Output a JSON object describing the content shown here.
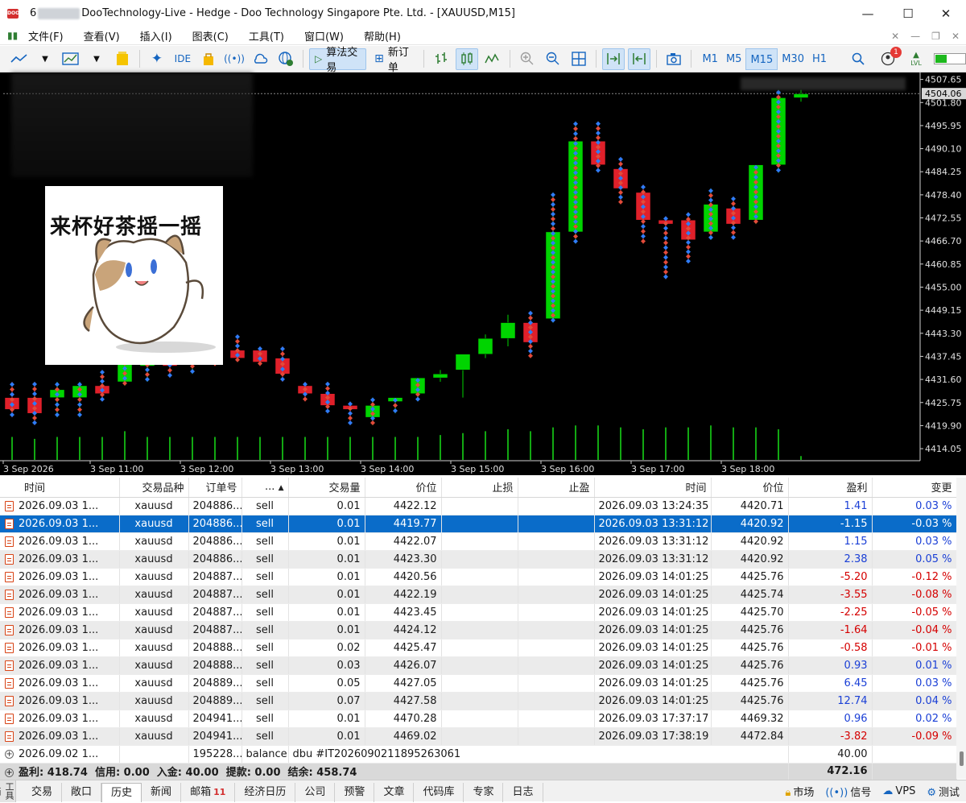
{
  "window": {
    "title_prefix": "6",
    "title_main": "DooTechnology-Live - Hedge - Doo Technology Singapore Pte. Ltd. - [XAUUSD,M15]",
    "minimize": "—",
    "maximize": "☐",
    "close": "✕"
  },
  "menu": {
    "items": [
      "文件(F)",
      "查看(V)",
      "插入(I)",
      "图表(C)",
      "工具(T)",
      "窗口(W)",
      "帮助(H)"
    ]
  },
  "toolbar": {
    "ide_label": "IDE",
    "algo_trading_label": "算法交易",
    "new_order_label": "新订单",
    "timeframes": [
      "M1",
      "M5",
      "M15",
      "M30",
      "H1"
    ],
    "active_timeframe": "M15",
    "notification_count": "1",
    "level_label": "LVL"
  },
  "chart": {
    "symbol": "XAUUSD",
    "timeframe": "M15",
    "sticker_text": "来杯好茶摇一摇",
    "current_price": "4504.06",
    "price_ticks": [
      "4507.65",
      "4501.80",
      "4495.95",
      "4490.10",
      "4484.25",
      "4478.40",
      "4472.55",
      "4466.70",
      "4460.85",
      "4455.00",
      "4449.15",
      "4443.30",
      "4437.45",
      "4431.60",
      "4425.75",
      "4419.90",
      "4414.05"
    ],
    "time_ticks": [
      "3 Sep 2026",
      "3 Sep 11:00",
      "3 Sep 12:00",
      "3 Sep 13:00",
      "3 Sep 14:00",
      "3 Sep 15:00",
      "3 Sep 16:00",
      "3 Sep 17:00",
      "3 Sep 18:00"
    ],
    "colors": {
      "bull": "#00d400",
      "bear": "#e0202a",
      "background": "#000000",
      "grid": "#1a1a1a",
      "volume": "#12a812"
    }
  },
  "chart_data": {
    "type": "candlestick",
    "symbol": "XAUUSD",
    "timeframe": "M15",
    "ylim": [
      4411,
      4509
    ],
    "candles": [
      {
        "o": 4427,
        "h": 4431,
        "l": 4422,
        "c": 4424
      },
      {
        "o": 4427,
        "h": 4431,
        "l": 4420,
        "c": 4423
      },
      {
        "o": 4427,
        "h": 4431,
        "l": 4422,
        "c": 4429
      },
      {
        "o": 4427,
        "h": 4431,
        "l": 4422,
        "c": 4430
      },
      {
        "o": 4430,
        "h": 4434,
        "l": 4426,
        "c": 4428
      },
      {
        "o": 4431,
        "h": 4445,
        "l": 4430,
        "c": 4443
      },
      {
        "o": 4435,
        "h": 4442,
        "l": 4431,
        "c": 4441
      },
      {
        "o": 4440,
        "h": 4441,
        "l": 4432,
        "c": 4435
      },
      {
        "o": 4438,
        "h": 4442,
        "l": 4433,
        "c": 4441
      },
      {
        "o": 4438,
        "h": 4442,
        "l": 4435,
        "c": 4437
      },
      {
        "o": 4439,
        "h": 4443,
        "l": 4436,
        "c": 4437
      },
      {
        "o": 4439,
        "h": 4440,
        "l": 4435,
        "c": 4436
      },
      {
        "o": 4437,
        "h": 4440,
        "l": 4431,
        "c": 4433
      },
      {
        "o": 4430,
        "h": 4431,
        "l": 4426,
        "c": 4428
      },
      {
        "o": 4428,
        "h": 4431,
        "l": 4423,
        "c": 4425
      },
      {
        "o": 4425,
        "h": 4426,
        "l": 4420,
        "c": 4424
      },
      {
        "o": 4422,
        "h": 4427,
        "l": 4420,
        "c": 4425
      },
      {
        "o": 4426,
        "h": 4427,
        "l": 4423,
        "c": 4427
      },
      {
        "o": 4428,
        "h": 4432,
        "l": 4426,
        "c": 4432
      },
      {
        "o": 4432,
        "h": 4434,
        "l": 4431,
        "c": 4433
      },
      {
        "o": 4434,
        "h": 4438,
        "l": 4427,
        "c": 4438
      },
      {
        "o": 4438,
        "h": 4443,
        "l": 4437,
        "c": 4442
      },
      {
        "o": 4442,
        "h": 4448,
        "l": 4440,
        "c": 4446
      },
      {
        "o": 4446,
        "h": 4449,
        "l": 4437,
        "c": 4441
      },
      {
        "o": 4447,
        "h": 4479,
        "l": 4446,
        "c": 4469
      },
      {
        "o": 4469,
        "h": 4497,
        "l": 4466,
        "c": 4492
      },
      {
        "o": 4492,
        "h": 4497,
        "l": 4484,
        "c": 4486
      },
      {
        "o": 4485,
        "h": 4488,
        "l": 4476,
        "c": 4480
      },
      {
        "o": 4479,
        "h": 4481,
        "l": 4466,
        "c": 4472
      },
      {
        "o": 4472,
        "h": 4473,
        "l": 4457,
        "c": 4471
      },
      {
        "o": 4472,
        "h": 4474,
        "l": 4461,
        "c": 4467
      },
      {
        "o": 4469,
        "h": 4480,
        "l": 4467,
        "c": 4476
      },
      {
        "o": 4475,
        "h": 4478,
        "l": 4467,
        "c": 4471
      },
      {
        "o": 4472,
        "h": 4486,
        "l": 4471,
        "c": 4486
      },
      {
        "o": 4486,
        "h": 4505,
        "l": 4484,
        "c": 4503
      },
      {
        "o": 4503,
        "h": 4505,
        "l": 4502,
        "c": 4504
      }
    ],
    "volume": [
      12,
      11,
      12,
      12,
      12,
      15,
      12,
      12,
      12,
      12,
      12,
      12,
      12,
      12,
      12,
      12,
      12,
      12,
      12,
      13,
      14,
      15,
      16,
      15,
      17,
      18,
      18,
      17,
      16,
      17,
      17,
      18,
      17,
      17,
      16,
      2
    ]
  },
  "history": {
    "columns": [
      "时间",
      "交易品种",
      "订单号",
      "...",
      "交易量",
      "价位",
      "止损",
      "止盈",
      "时间",
      "价位",
      "盈利",
      "变更"
    ],
    "rows": [
      {
        "open_time": "2026.09.03 1...",
        "symbol": "xauusd",
        "ticket": "204886...",
        "type": "sell",
        "volume": "0.01",
        "open_price": "4422.12",
        "sl": "",
        "tp": "",
        "close_time": "2026.09.03 13:24:35",
        "close_price": "4420.71",
        "profit": "1.41",
        "change": "0.03 %",
        "sign": "pos",
        "selected": false
      },
      {
        "open_time": "2026.09.03 1...",
        "symbol": "xauusd",
        "ticket": "204886...",
        "type": "sell",
        "volume": "0.01",
        "open_price": "4419.77",
        "sl": "",
        "tp": "",
        "close_time": "2026.09.03 13:31:12",
        "close_price": "4420.92",
        "profit": "-1.15",
        "change": "-0.03 %",
        "sign": "neg",
        "selected": true
      },
      {
        "open_time": "2026.09.03 1...",
        "symbol": "xauusd",
        "ticket": "204886...",
        "type": "sell",
        "volume": "0.01",
        "open_price": "4422.07",
        "sl": "",
        "tp": "",
        "close_time": "2026.09.03 13:31:12",
        "close_price": "4420.92",
        "profit": "1.15",
        "change": "0.03 %",
        "sign": "pos",
        "selected": false
      },
      {
        "open_time": "2026.09.03 1...",
        "symbol": "xauusd",
        "ticket": "204886...",
        "type": "sell",
        "volume": "0.01",
        "open_price": "4423.30",
        "sl": "",
        "tp": "",
        "close_time": "2026.09.03 13:31:12",
        "close_price": "4420.92",
        "profit": "2.38",
        "change": "0.05 %",
        "sign": "pos",
        "selected": false
      },
      {
        "open_time": "2026.09.03 1...",
        "symbol": "xauusd",
        "ticket": "204887...",
        "type": "sell",
        "volume": "0.01",
        "open_price": "4420.56",
        "sl": "",
        "tp": "",
        "close_time": "2026.09.03 14:01:25",
        "close_price": "4425.76",
        "profit": "-5.20",
        "change": "-0.12 %",
        "sign": "neg",
        "selected": false
      },
      {
        "open_time": "2026.09.03 1...",
        "symbol": "xauusd",
        "ticket": "204887...",
        "type": "sell",
        "volume": "0.01",
        "open_price": "4422.19",
        "sl": "",
        "tp": "",
        "close_time": "2026.09.03 14:01:25",
        "close_price": "4425.74",
        "profit": "-3.55",
        "change": "-0.08 %",
        "sign": "neg",
        "selected": false
      },
      {
        "open_time": "2026.09.03 1...",
        "symbol": "xauusd",
        "ticket": "204887...",
        "type": "sell",
        "volume": "0.01",
        "open_price": "4423.45",
        "sl": "",
        "tp": "",
        "close_time": "2026.09.03 14:01:25",
        "close_price": "4425.70",
        "profit": "-2.25",
        "change": "-0.05 %",
        "sign": "neg",
        "selected": false
      },
      {
        "open_time": "2026.09.03 1...",
        "symbol": "xauusd",
        "ticket": "204887...",
        "type": "sell",
        "volume": "0.01",
        "open_price": "4424.12",
        "sl": "",
        "tp": "",
        "close_time": "2026.09.03 14:01:25",
        "close_price": "4425.76",
        "profit": "-1.64",
        "change": "-0.04 %",
        "sign": "neg",
        "selected": false
      },
      {
        "open_time": "2026.09.03 1...",
        "symbol": "xauusd",
        "ticket": "204888...",
        "type": "sell",
        "volume": "0.02",
        "open_price": "4425.47",
        "sl": "",
        "tp": "",
        "close_time": "2026.09.03 14:01:25",
        "close_price": "4425.76",
        "profit": "-0.58",
        "change": "-0.01 %",
        "sign": "neg",
        "selected": false
      },
      {
        "open_time": "2026.09.03 1...",
        "symbol": "xauusd",
        "ticket": "204888...",
        "type": "sell",
        "volume": "0.03",
        "open_price": "4426.07",
        "sl": "",
        "tp": "",
        "close_time": "2026.09.03 14:01:25",
        "close_price": "4425.76",
        "profit": "0.93",
        "change": "0.01 %",
        "sign": "pos",
        "selected": false
      },
      {
        "open_time": "2026.09.03 1...",
        "symbol": "xauusd",
        "ticket": "204889...",
        "type": "sell",
        "volume": "0.05",
        "open_price": "4427.05",
        "sl": "",
        "tp": "",
        "close_time": "2026.09.03 14:01:25",
        "close_price": "4425.76",
        "profit": "6.45",
        "change": "0.03 %",
        "sign": "pos",
        "selected": false
      },
      {
        "open_time": "2026.09.03 1...",
        "symbol": "xauusd",
        "ticket": "204889...",
        "type": "sell",
        "volume": "0.07",
        "open_price": "4427.58",
        "sl": "",
        "tp": "",
        "close_time": "2026.09.03 14:01:25",
        "close_price": "4425.76",
        "profit": "12.74",
        "change": "0.04 %",
        "sign": "pos",
        "selected": false
      },
      {
        "open_time": "2026.09.03 1...",
        "symbol": "xauusd",
        "ticket": "204941...",
        "type": "sell",
        "volume": "0.01",
        "open_price": "4470.28",
        "sl": "",
        "tp": "",
        "close_time": "2026.09.03 17:37:17",
        "close_price": "4469.32",
        "profit": "0.96",
        "change": "0.02 %",
        "sign": "pos",
        "selected": false
      },
      {
        "open_time": "2026.09.03 1...",
        "symbol": "xauusd",
        "ticket": "204941...",
        "type": "sell",
        "volume": "0.01",
        "open_price": "4469.02",
        "sl": "",
        "tp": "",
        "close_time": "2026.09.03 17:38:19",
        "close_price": "4472.84",
        "profit": "-3.82",
        "change": "-0.09 %",
        "sign": "neg",
        "selected": false
      }
    ],
    "balance_row": {
      "time": "2026.09.02 1...",
      "ticket": "195228...",
      "type": "balance",
      "comment": "dbu #IT2026090211895263061",
      "profit": "40.00"
    },
    "summary": {
      "text": "盈利: 418.74  信用: 0.00  入金: 40.00  提款: 0.00  结余: 458.74",
      "total": "472.16"
    }
  },
  "bottom_tabs": {
    "side_label": "工具箱",
    "tabs": [
      "交易",
      "敞口",
      "历史",
      "新闻",
      "邮箱",
      "经济日历",
      "公司",
      "预警",
      "文章",
      "代码库",
      "专家",
      "日志"
    ],
    "active": "历史",
    "mail_badge": "11",
    "status": {
      "market": "市场",
      "signals": "信号",
      "vps": "VPS",
      "tester": "测试"
    }
  }
}
